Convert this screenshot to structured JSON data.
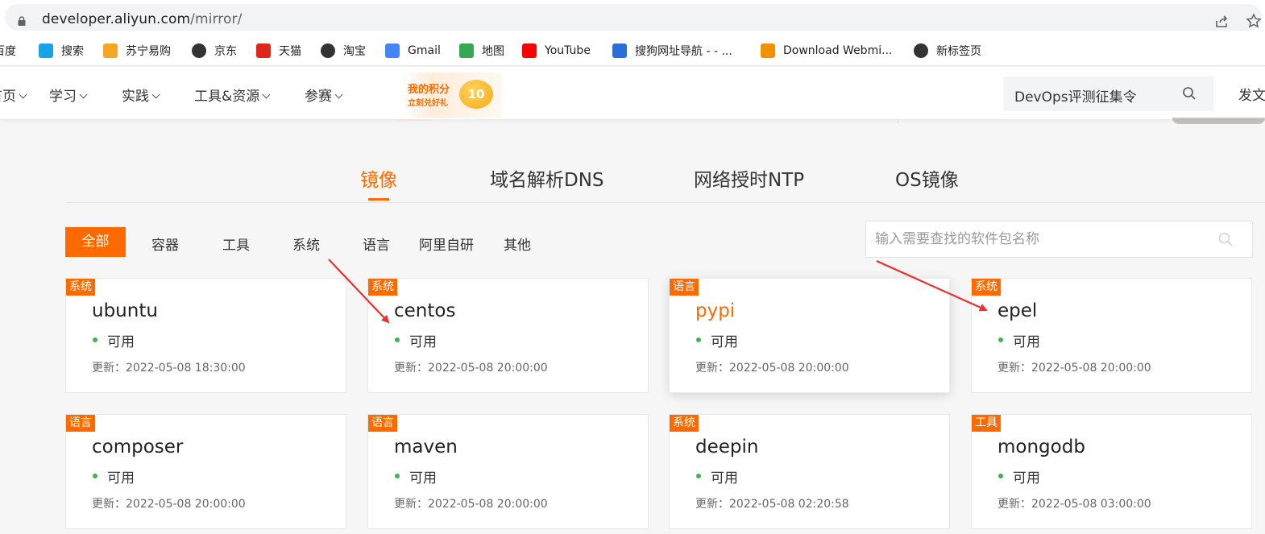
{
  "browser": {
    "url_host": "developer.aliyun.com",
    "url_path": "/mirror/"
  },
  "bookmarks": [
    {
      "label": "百度",
      "icon": "baidu-icon",
      "color": "#2932e1"
    },
    {
      "label": "搜索",
      "icon": "search-brand-icon",
      "color": "#1aa1e8"
    },
    {
      "label": "苏宁易购",
      "icon": "suning-icon",
      "color": "#f5a623"
    },
    {
      "label": "京东",
      "icon": "globe-icon",
      "color": "#333333"
    },
    {
      "label": "天猫",
      "icon": "tmall-icon",
      "color": "#e1251b"
    },
    {
      "label": "淘宝",
      "icon": "globe-icon",
      "color": "#333333"
    },
    {
      "label": "Gmail",
      "icon": "google-icon",
      "color": "#4285f4"
    },
    {
      "label": "地图",
      "icon": "maps-icon",
      "color": "#34a853"
    },
    {
      "label": "YouTube",
      "icon": "youtube-icon",
      "color": "#ff0000"
    },
    {
      "label": "搜狗网址导航 - - ...",
      "icon": "sogou-icon",
      "color": "#2a6fd6"
    },
    {
      "label": "Download Webmi...",
      "icon": "webmin-icon",
      "color": "#f29100"
    },
    {
      "label": "新标签页",
      "icon": "globe-icon",
      "color": "#333333"
    }
  ],
  "site_nav": {
    "items": [
      "首页",
      "学习",
      "实践",
      "工具&资源",
      "参赛"
    ],
    "promo_line1": "我的积分",
    "promo_line2": "立刻兑好礼",
    "promo_points": "10",
    "search_text": "DevOps评测征集令",
    "publish_label": "发文"
  },
  "tabs": [
    {
      "label": "镜像",
      "active": true
    },
    {
      "label": "域名解析DNS",
      "active": false
    },
    {
      "label": "网络授时NTP",
      "active": false
    },
    {
      "label": "OS镜像",
      "active": false
    }
  ],
  "filters": {
    "active": "全部",
    "items": [
      "容器",
      "工具",
      "系统",
      "语言",
      "阿里自研",
      "其他"
    ]
  },
  "search": {
    "placeholder": "输入需要查找的软件包名称"
  },
  "cards": [
    {
      "tag": "系统",
      "name": "ubuntu",
      "status": "可用",
      "updated": "更新：2022-05-08 18:30:00",
      "hovered": false
    },
    {
      "tag": "系统",
      "name": "centos",
      "status": "可用",
      "updated": "更新：2022-05-08 20:00:00",
      "hovered": false
    },
    {
      "tag": "语言",
      "name": "pypi",
      "status": "可用",
      "updated": "更新：2022-05-08 20:00:00",
      "hovered": true
    },
    {
      "tag": "系统",
      "name": "epel",
      "status": "可用",
      "updated": "更新：2022-05-08 20:00:00",
      "hovered": false
    },
    {
      "tag": "语言",
      "name": "composer",
      "status": "可用",
      "updated": "更新：2022-05-08 20:00:00",
      "hovered": false
    },
    {
      "tag": "语言",
      "name": "maven",
      "status": "可用",
      "updated": "更新：2022-05-08 20:00:00",
      "hovered": false
    },
    {
      "tag": "系统",
      "name": "deepin",
      "status": "可用",
      "updated": "更新：2022-05-08 02:20:58",
      "hovered": false
    },
    {
      "tag": "工具",
      "name": "mongodb",
      "status": "可用",
      "updated": "更新：2022-05-08 03:00:00",
      "hovered": false
    }
  ],
  "colors": {
    "accent": "#ff6a00",
    "status_ok": "#40b454",
    "annotation_arrow": "#e8322e"
  }
}
